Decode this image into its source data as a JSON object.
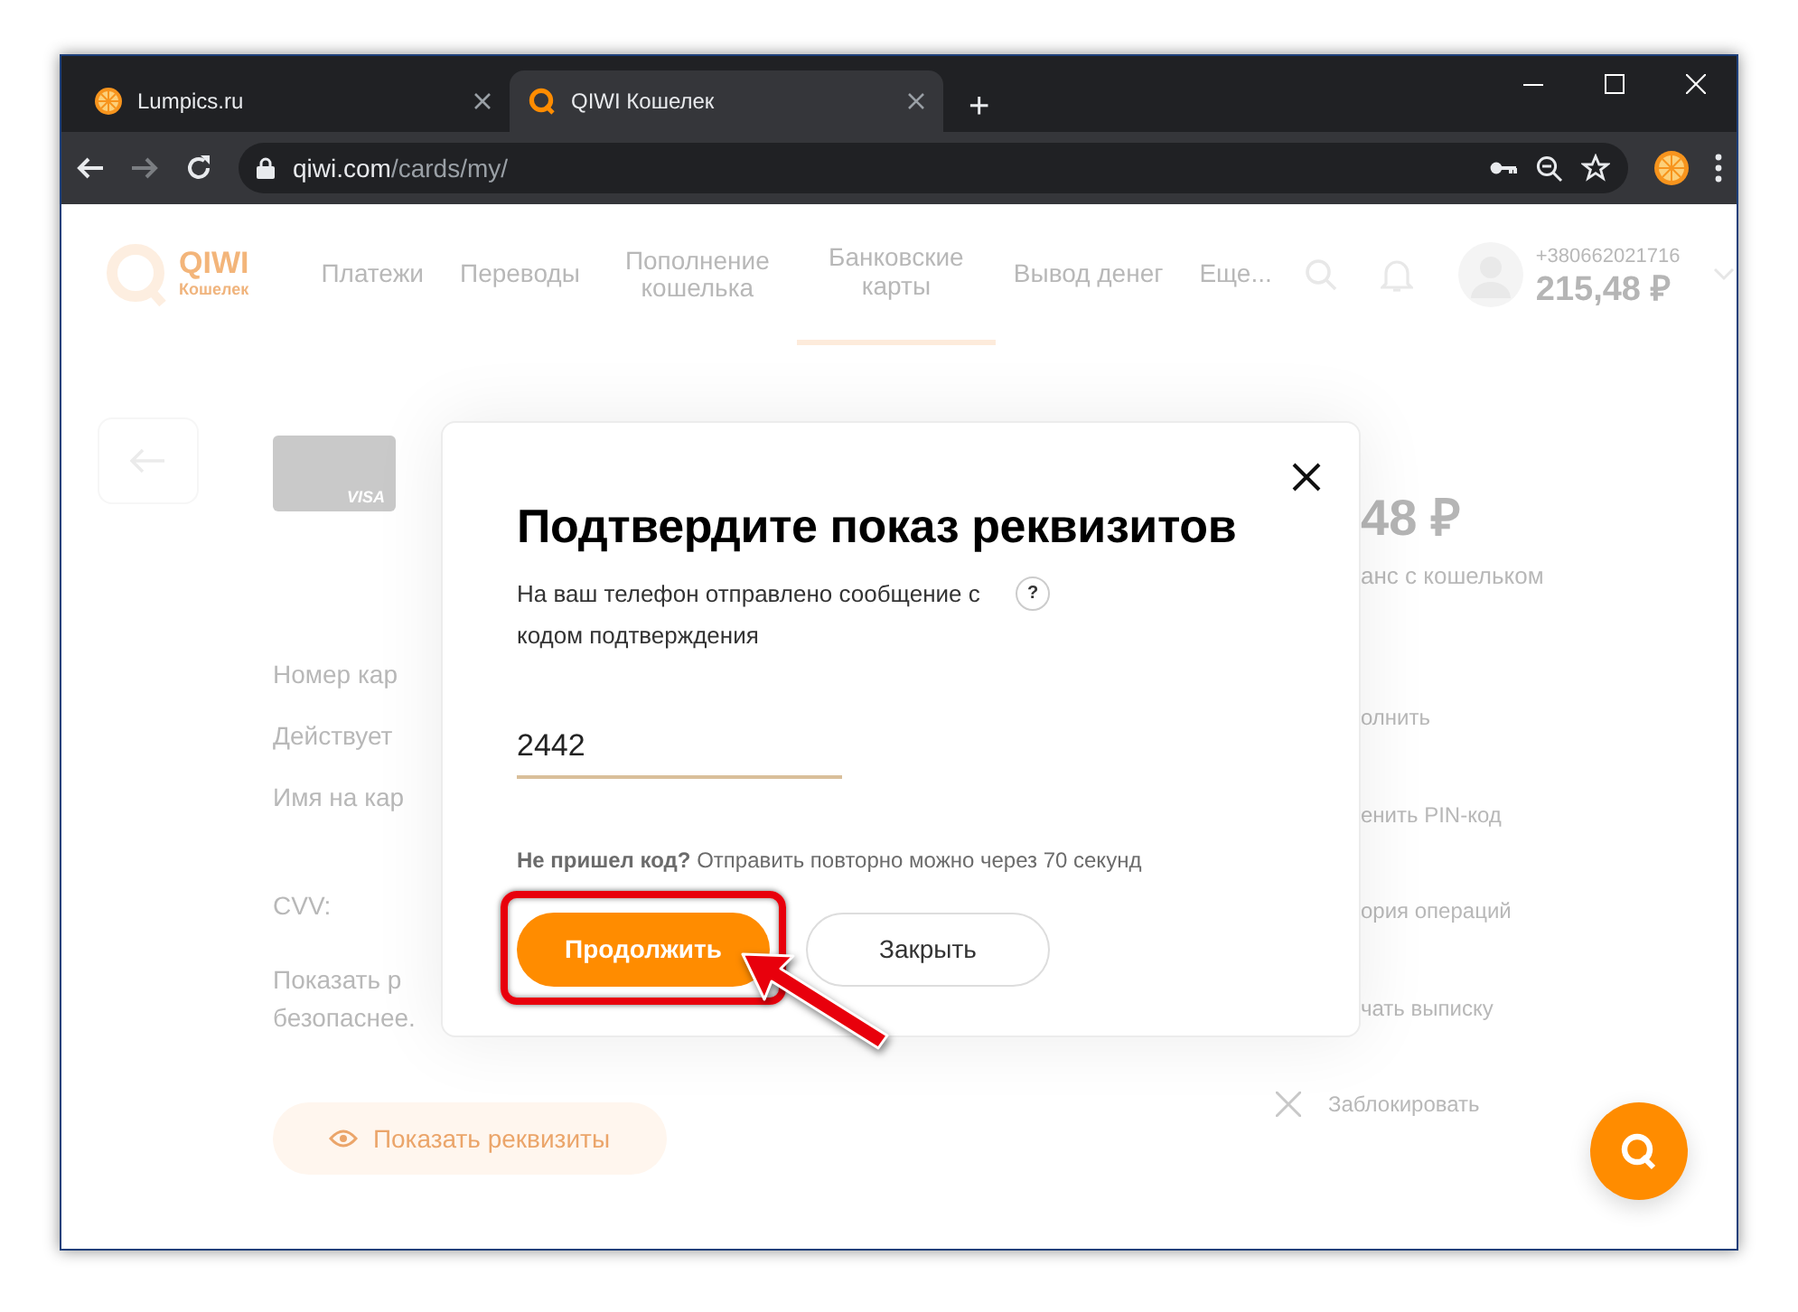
{
  "browser": {
    "tabs": [
      {
        "title": "Lumpics.ru",
        "selected": false
      },
      {
        "title": "QIWI Кошелек",
        "selected": true
      }
    ],
    "new_tab": "+",
    "address": {
      "host": "qiwi.com",
      "path": "/cards/my/"
    }
  },
  "page": {
    "logo": {
      "name": "QIWI",
      "sub": "Кошелек"
    },
    "nav": [
      {
        "label": "Платежи",
        "selected": false
      },
      {
        "label": "Переводы",
        "selected": false
      },
      {
        "label": "Пополнение кошелька",
        "selected": false
      },
      {
        "label": "Банковские карты",
        "selected": true
      },
      {
        "label": "Вывод денег",
        "selected": false
      },
      {
        "label": "Еще...",
        "selected": false
      }
    ],
    "user": {
      "phone": "+380662021716",
      "balance": "215,48 ₽"
    },
    "card_brand": "VISA",
    "card_fields": [
      "Номер кар",
      "Действует",
      "Имя на кар"
    ],
    "cvv_label": "CVV:",
    "note_lines": [
      "Показать р",
      "безопаснее."
    ],
    "show_button": "Показать реквизиты",
    "balance": "48 ₽",
    "balance_note": "анс с кошельком",
    "actions": [
      {
        "label": "олнить"
      },
      {
        "label": "енить PIN-код"
      },
      {
        "label": "ория операций"
      },
      {
        "label": "чать выписку"
      },
      {
        "label": "Заблокировать"
      }
    ]
  },
  "modal": {
    "title": "Подтвердите показ реквизитов",
    "message": "На ваш телефон отправлено сообщение с кодом подтверждения",
    "help": "?",
    "code": "2442",
    "resend": "**Не пришел код?** Отправить повторно можно через 70 секунд",
    "buttons": [
      {
        "label": "Продолжить",
        "kind": "primary",
        "highlighted": true
      },
      {
        "label": "Закрыть",
        "kind": "secondary",
        "highlighted": false
      }
    ]
  }
}
